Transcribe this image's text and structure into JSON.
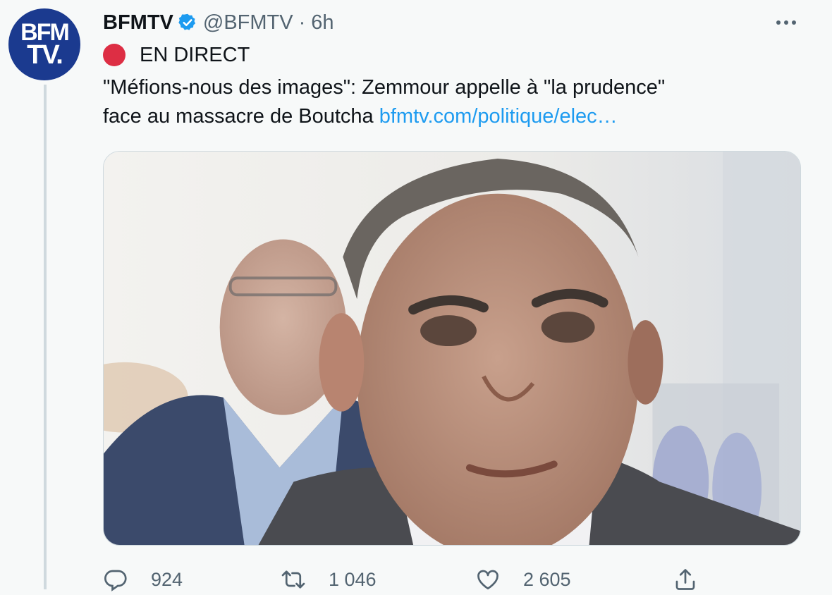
{
  "author": {
    "avatar_line1": "BFM",
    "avatar_line2": "TV.",
    "name": "BFMTV",
    "handle": "@BFMTV",
    "separator": "·",
    "time": "6h",
    "verified": true
  },
  "tweet": {
    "live_label": "EN DIRECT",
    "line1": "\"Méfions-nous des images\": Zemmour appelle à \"la prudence\"",
    "line2": "face au massacre de Boutcha ",
    "link": "bfmtv.com/politique/elec…"
  },
  "actions": {
    "reply_count": "924",
    "retweet_count": "1 046",
    "like_count": "2 605"
  },
  "icons": {
    "verified": "verified-badge-icon",
    "more": "more-options-icon",
    "reply": "reply-icon",
    "retweet": "retweet-icon",
    "like": "heart-icon",
    "share": "share-icon"
  },
  "colors": {
    "accent": "#1d9bf0",
    "live": "#dd2e44",
    "avatar_bg": "#1b3a8f",
    "muted": "#536471"
  }
}
